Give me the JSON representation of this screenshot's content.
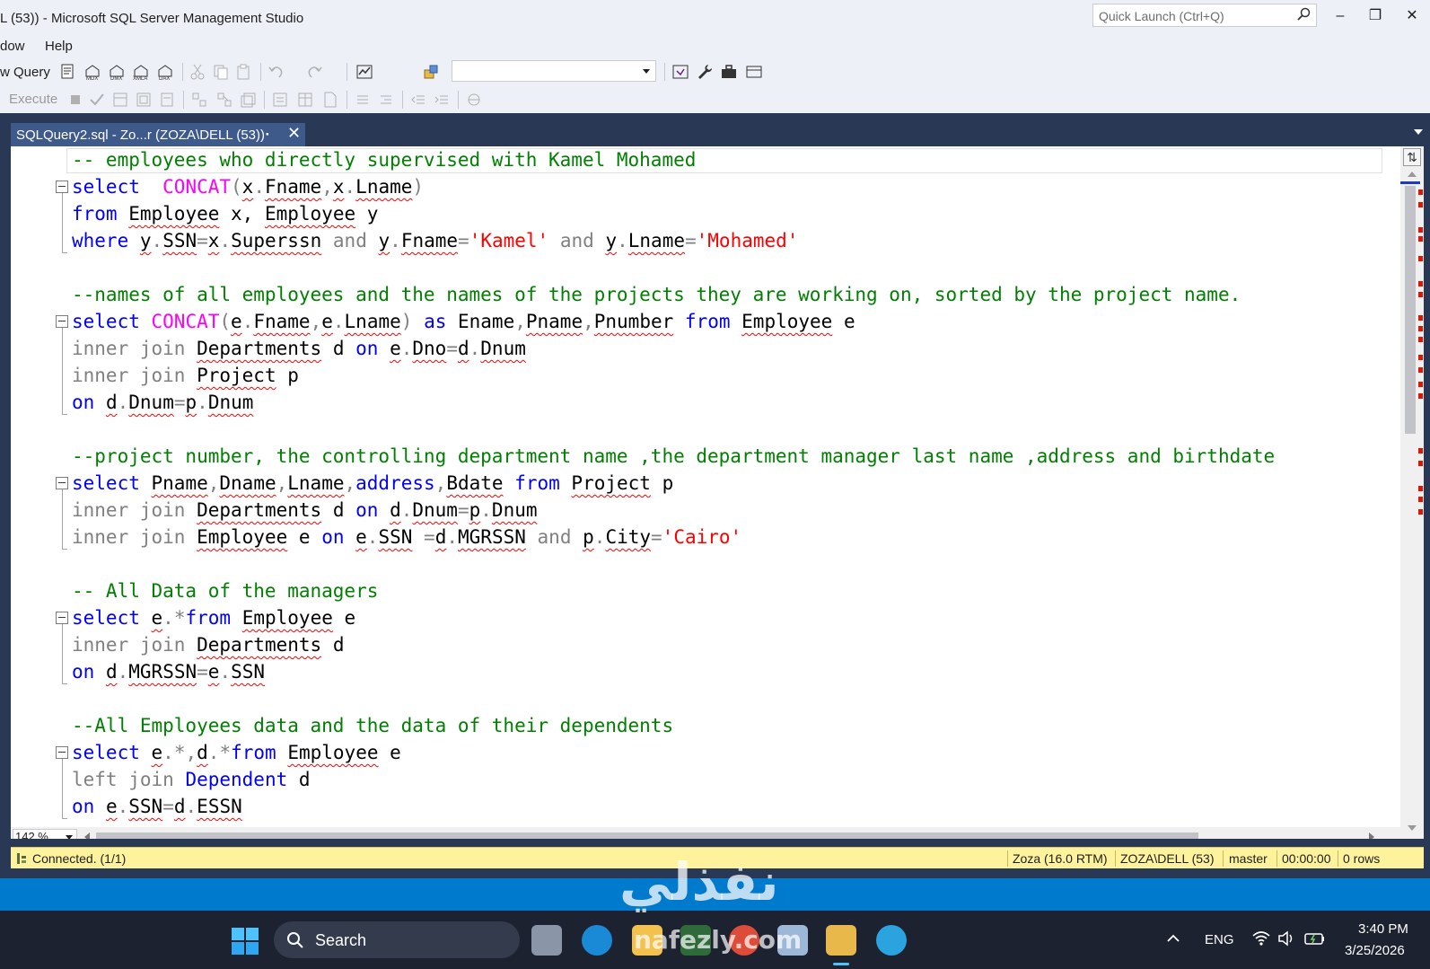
{
  "window": {
    "title": "L (53)) - Microsoft SQL Server Management Studio",
    "quick_launch_placeholder": "Quick Launch (Ctrl+Q)",
    "minimize": "–",
    "restore": "❐",
    "close": "✕"
  },
  "menu": {
    "items": [
      "dow",
      "Help"
    ]
  },
  "toolbar": {
    "new_query_label": "w Query",
    "execute_label": "Execute",
    "database_combo_value": ""
  },
  "doc_tab": {
    "title": "SQLQuery2.sql - Zo...r (ZOZA\\DELL (53))",
    "pin": "⬝",
    "close": "✕"
  },
  "code_lines": [
    [
      [
        "c",
        "-- employees who directly supervised with Kamel Mohamed"
      ]
    ],
    [
      [
        "k",
        "select"
      ],
      [
        "",
        "  "
      ],
      [
        "f",
        "CONCAT"
      ],
      [
        "g",
        "("
      ],
      [
        "u",
        "x"
      ],
      [
        "g",
        "."
      ],
      [
        "u",
        "Fname"
      ],
      [
        "g",
        ","
      ],
      [
        "u",
        "x"
      ],
      [
        "g",
        "."
      ],
      [
        "u",
        "Lname"
      ],
      [
        "g",
        ")"
      ]
    ],
    [
      [
        "k",
        "from"
      ],
      [
        "",
        " "
      ],
      [
        "u",
        "Employee"
      ],
      [
        "",
        " x, "
      ],
      [
        "u",
        "Employee"
      ],
      [
        "",
        " y"
      ]
    ],
    [
      [
        "k",
        "where"
      ],
      [
        "",
        " "
      ],
      [
        "u",
        "y"
      ],
      [
        "g",
        "."
      ],
      [
        "u",
        "SSN"
      ],
      [
        "g",
        "="
      ],
      [
        "u",
        "x"
      ],
      [
        "g",
        "."
      ],
      [
        "u",
        "Superssn"
      ],
      [
        "",
        " "
      ],
      [
        "g",
        "and"
      ],
      [
        "",
        " "
      ],
      [
        "u",
        "y"
      ],
      [
        "g",
        "."
      ],
      [
        "u",
        "Fname"
      ],
      [
        "g",
        "="
      ],
      [
        "s",
        "'Kamel'"
      ],
      [
        "",
        " "
      ],
      [
        "g",
        "and"
      ],
      [
        "",
        " "
      ],
      [
        "u",
        "y"
      ],
      [
        "g",
        "."
      ],
      [
        "u",
        "Lname"
      ],
      [
        "g",
        "="
      ],
      [
        "s",
        "'Mohamed'"
      ]
    ],
    [],
    [
      [
        "c",
        "--names of all employees and the names of the projects they are working on, sorted by the project name."
      ]
    ],
    [
      [
        "k",
        "select"
      ],
      [
        "",
        " "
      ],
      [
        "f",
        "CONCAT"
      ],
      [
        "g",
        "("
      ],
      [
        "u",
        "e"
      ],
      [
        "g",
        "."
      ],
      [
        "u",
        "Fname"
      ],
      [
        "g",
        ","
      ],
      [
        "u",
        "e"
      ],
      [
        "g",
        "."
      ],
      [
        "u",
        "Lname"
      ],
      [
        "g",
        ")"
      ],
      [
        "",
        " "
      ],
      [
        "k",
        "as"
      ],
      [
        "",
        " Ename"
      ],
      [
        "g",
        ","
      ],
      [
        "u",
        "Pname"
      ],
      [
        "g",
        ","
      ],
      [
        "u",
        "Pnumber"
      ],
      [
        "",
        " "
      ],
      [
        "k",
        "from"
      ],
      [
        "",
        " "
      ],
      [
        "u",
        "Employee"
      ],
      [
        "",
        " e"
      ]
    ],
    [
      [
        "g",
        "inner join"
      ],
      [
        "",
        " "
      ],
      [
        "u",
        "Departments"
      ],
      [
        "",
        " d "
      ],
      [
        "k",
        "on"
      ],
      [
        "",
        " "
      ],
      [
        "u",
        "e"
      ],
      [
        "g",
        "."
      ],
      [
        "u",
        "Dno"
      ],
      [
        "g",
        "="
      ],
      [
        "u",
        "d"
      ],
      [
        "g",
        "."
      ],
      [
        "u",
        "Dnum"
      ]
    ],
    [
      [
        "g",
        "inner join"
      ],
      [
        "",
        " "
      ],
      [
        "u",
        "Project"
      ],
      [
        "",
        " p"
      ]
    ],
    [
      [
        "k",
        "on"
      ],
      [
        "",
        " "
      ],
      [
        "u",
        "d"
      ],
      [
        "g",
        "."
      ],
      [
        "u",
        "Dnum"
      ],
      [
        "g",
        "="
      ],
      [
        "u",
        "p"
      ],
      [
        "g",
        "."
      ],
      [
        "u",
        "Dnum"
      ]
    ],
    [],
    [
      [
        "c",
        "--project number, the controlling department name ,the department manager last name ,address and birthdate"
      ]
    ],
    [
      [
        "k",
        "select"
      ],
      [
        "",
        " "
      ],
      [
        "u",
        "Pname"
      ],
      [
        "g",
        ","
      ],
      [
        "u",
        "Dname"
      ],
      [
        "g",
        ","
      ],
      [
        "u",
        "Lname"
      ],
      [
        "g",
        ","
      ],
      [
        "k",
        "address"
      ],
      [
        "g",
        ","
      ],
      [
        "u",
        "Bdate"
      ],
      [
        "",
        " "
      ],
      [
        "k",
        "from"
      ],
      [
        "",
        " "
      ],
      [
        "u",
        "Project"
      ],
      [
        "",
        " p"
      ]
    ],
    [
      [
        "g",
        "inner join"
      ],
      [
        "",
        " "
      ],
      [
        "u",
        "Departments"
      ],
      [
        "",
        " d "
      ],
      [
        "k",
        "on"
      ],
      [
        "",
        " "
      ],
      [
        "u",
        "d"
      ],
      [
        "g",
        "."
      ],
      [
        "u",
        "Dnum"
      ],
      [
        "g",
        "="
      ],
      [
        "u",
        "p"
      ],
      [
        "g",
        "."
      ],
      [
        "u",
        "Dnum"
      ]
    ],
    [
      [
        "g",
        "inner join"
      ],
      [
        "",
        " "
      ],
      [
        "u",
        "Employee"
      ],
      [
        "",
        " e "
      ],
      [
        "k",
        "on"
      ],
      [
        "",
        " "
      ],
      [
        "u",
        "e"
      ],
      [
        "g",
        "."
      ],
      [
        "u",
        "SSN"
      ],
      [
        "",
        " "
      ],
      [
        "g",
        "="
      ],
      [
        "u",
        "d"
      ],
      [
        "g",
        "."
      ],
      [
        "u",
        "MGRSSN"
      ],
      [
        "",
        " "
      ],
      [
        "g",
        "and"
      ],
      [
        "",
        " "
      ],
      [
        "u",
        "p"
      ],
      [
        "g",
        "."
      ],
      [
        "u",
        "City"
      ],
      [
        "g",
        "="
      ],
      [
        "s",
        "'Cairo'"
      ]
    ],
    [],
    [
      [
        "c",
        "-- All Data of the managers"
      ]
    ],
    [
      [
        "k",
        "select"
      ],
      [
        "",
        " "
      ],
      [
        "u",
        "e"
      ],
      [
        "g",
        "."
      ],
      [
        "g",
        "*"
      ],
      [
        "k",
        "from"
      ],
      [
        "",
        " "
      ],
      [
        "u",
        "Employee"
      ],
      [
        "",
        " e"
      ]
    ],
    [
      [
        "g",
        "inner join"
      ],
      [
        "",
        " "
      ],
      [
        "u",
        "Departments"
      ],
      [
        "",
        " d"
      ]
    ],
    [
      [
        "k",
        "on"
      ],
      [
        "",
        " "
      ],
      [
        "u",
        "d"
      ],
      [
        "g",
        "."
      ],
      [
        "u",
        "MGRSSN"
      ],
      [
        "g",
        "="
      ],
      [
        "u",
        "e"
      ],
      [
        "g",
        "."
      ],
      [
        "u",
        "SSN"
      ]
    ],
    [],
    [
      [
        "c",
        "--All Employees data and the data of their dependents"
      ]
    ],
    [
      [
        "k",
        "select"
      ],
      [
        "",
        " "
      ],
      [
        "u",
        "e"
      ],
      [
        "g",
        "."
      ],
      [
        "g",
        "*"
      ],
      [
        "g",
        ","
      ],
      [
        "u",
        "d"
      ],
      [
        "g",
        "."
      ],
      [
        "g",
        "*"
      ],
      [
        "k",
        "from"
      ],
      [
        "",
        " "
      ],
      [
        "u",
        "Employee"
      ],
      [
        "",
        " e"
      ]
    ],
    [
      [
        "g",
        "left join"
      ],
      [
        "",
        " "
      ],
      [
        "k",
        "Dependent"
      ],
      [
        "",
        " d"
      ]
    ],
    [
      [
        "k",
        "on"
      ],
      [
        "",
        " "
      ],
      [
        "u",
        "e"
      ],
      [
        "g",
        "."
      ],
      [
        "u",
        "SSN"
      ],
      [
        "g",
        "="
      ],
      [
        "u",
        "d"
      ],
      [
        "g",
        "."
      ],
      [
        "u",
        "ESSN"
      ]
    ]
  ],
  "zoom": "142 %",
  "query_status": {
    "connection": "Connected. (1/1)",
    "server": "Zoza (16.0 RTM)",
    "login": "ZOZA\\DELL (53)",
    "database": "master",
    "elapsed": "00:00:00",
    "rows": "0 rows"
  },
  "watermark": {
    "arabic": "نفذلي",
    "latin": "nafezly.com"
  },
  "taskbar": {
    "search_label": "Search",
    "language": "ENG",
    "time": "3:40 PM",
    "date": "3/25/2026"
  },
  "colors": {
    "keyword": "#0000ff",
    "function": "#ff00ff",
    "string": "#ff0000",
    "comment": "#008000",
    "operator": "#808080",
    "status_bar": "#007acc",
    "query_status_bar": "#fff29d"
  }
}
